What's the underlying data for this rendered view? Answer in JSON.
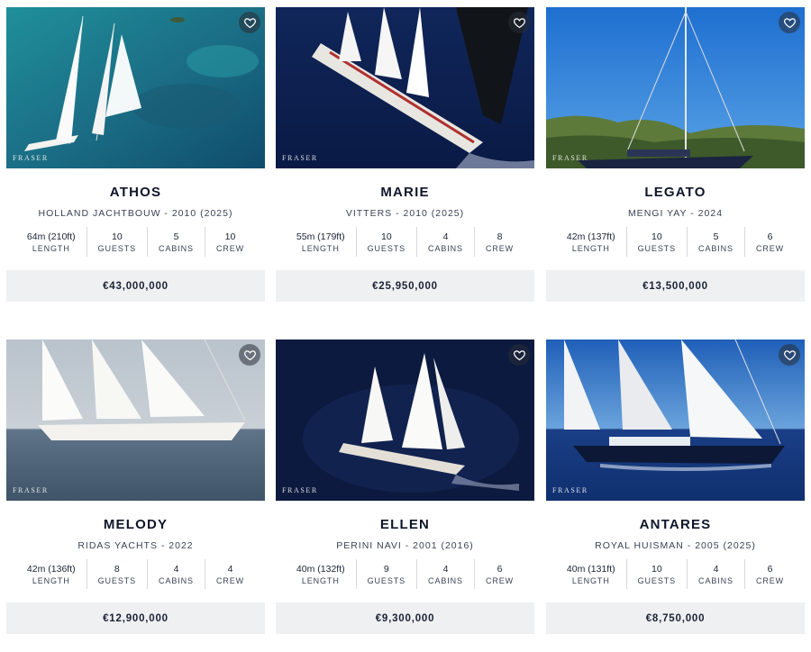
{
  "brand_watermark": "FRASER",
  "icons": {
    "favorite": "heart-outline-icon"
  },
  "colors": {
    "price_bg": "#eff0f2",
    "title": "#0e1629",
    "divider": "#d7d9de"
  },
  "yachts": [
    {
      "name": "ATHOS",
      "builder": "HOLLAND JACHTBOUW - 2010 (2025)",
      "specs": [
        {
          "value": "64m (210ft)",
          "label": "LENGTH"
        },
        {
          "value": "10",
          "label": "GUESTS"
        },
        {
          "value": "5",
          "label": "CABINS"
        },
        {
          "value": "10",
          "label": "CREW"
        }
      ],
      "price": "€43,000,000"
    },
    {
      "name": "MARIE",
      "builder": "VITTERS - 2010 (2025)",
      "specs": [
        {
          "value": "55m (179ft)",
          "label": "LENGTH"
        },
        {
          "value": "10",
          "label": "GUESTS"
        },
        {
          "value": "4",
          "label": "CABINS"
        },
        {
          "value": "8",
          "label": "CREW"
        }
      ],
      "price": "€25,950,000"
    },
    {
      "name": "LEGATO",
      "builder": "MENGI YAY - 2024",
      "specs": [
        {
          "value": "42m (137ft)",
          "label": "LENGTH"
        },
        {
          "value": "10",
          "label": "GUESTS"
        },
        {
          "value": "5",
          "label": "CABINS"
        },
        {
          "value": "6",
          "label": "CREW"
        }
      ],
      "price": "€13,500,000"
    },
    {
      "name": "MELODY",
      "builder": "RIDAS YACHTS - 2022",
      "specs": [
        {
          "value": "42m (136ft)",
          "label": "LENGTH"
        },
        {
          "value": "8",
          "label": "GUESTS"
        },
        {
          "value": "4",
          "label": "CABINS"
        },
        {
          "value": "4",
          "label": "CREW"
        }
      ],
      "price": "€12,900,000"
    },
    {
      "name": "ELLEN",
      "builder": "PERINI NAVI - 2001 (2016)",
      "specs": [
        {
          "value": "40m (132ft)",
          "label": "LENGTH"
        },
        {
          "value": "9",
          "label": "GUESTS"
        },
        {
          "value": "4",
          "label": "CABINS"
        },
        {
          "value": "6",
          "label": "CREW"
        }
      ],
      "price": "€9,300,000"
    },
    {
      "name": "ANTARES",
      "builder": "ROYAL HUISMAN - 2005 (2025)",
      "specs": [
        {
          "value": "40m (131ft)",
          "label": "LENGTH"
        },
        {
          "value": "10",
          "label": "GUESTS"
        },
        {
          "value": "4",
          "label": "CABINS"
        },
        {
          "value": "6",
          "label": "CREW"
        }
      ],
      "price": "€8,750,000"
    }
  ]
}
